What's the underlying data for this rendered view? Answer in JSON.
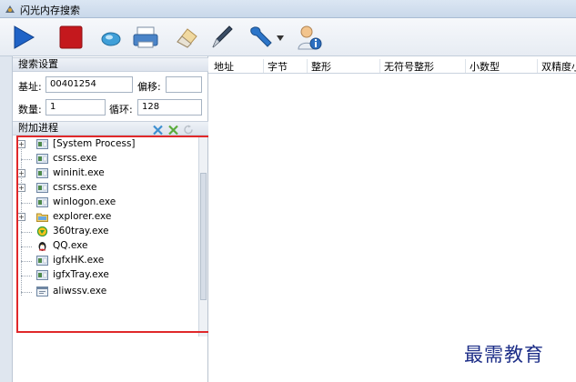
{
  "window": {
    "title": "闪光内存搜索"
  },
  "toolbar": {
    "buttons": [
      "play-icon",
      "stop-icon",
      "search-icon",
      "print-icon",
      "eraser-icon",
      "pen-icon",
      "wrench-icon",
      "user-info-icon"
    ]
  },
  "search_settings": {
    "section_label": "搜索设置",
    "base_label": "基址:",
    "base_value": "00401254",
    "offset_label": "偏移:",
    "offset_value": "",
    "count_label": "数量:",
    "count_value": "1",
    "loop_label": "循环:",
    "loop_value": "128"
  },
  "attach_process": {
    "section_label": "附加进程",
    "processes": [
      {
        "name": "[System Process]",
        "expandable": true
      },
      {
        "name": "csrss.exe",
        "expandable": false
      },
      {
        "name": "wininit.exe",
        "expandable": true
      },
      {
        "name": "csrss.exe",
        "expandable": true
      },
      {
        "name": "winlogon.exe",
        "expandable": false
      },
      {
        "name": "explorer.exe",
        "expandable": true
      },
      {
        "name": "360tray.exe",
        "expandable": false
      },
      {
        "name": "QQ.exe",
        "expandable": false
      },
      {
        "name": "igfxHK.exe",
        "expandable": false
      },
      {
        "name": "igfxTray.exe",
        "expandable": false
      },
      {
        "name": "aliwssv.exe",
        "expandable": false
      }
    ]
  },
  "results_table": {
    "columns": [
      "地址",
      "字节",
      "整形",
      "无符号整形",
      "小数型",
      "双精度小"
    ]
  },
  "watermark": "最需教育",
  "colors": {
    "highlight_box": "#e0282a",
    "watermark": "#1e2f88"
  }
}
